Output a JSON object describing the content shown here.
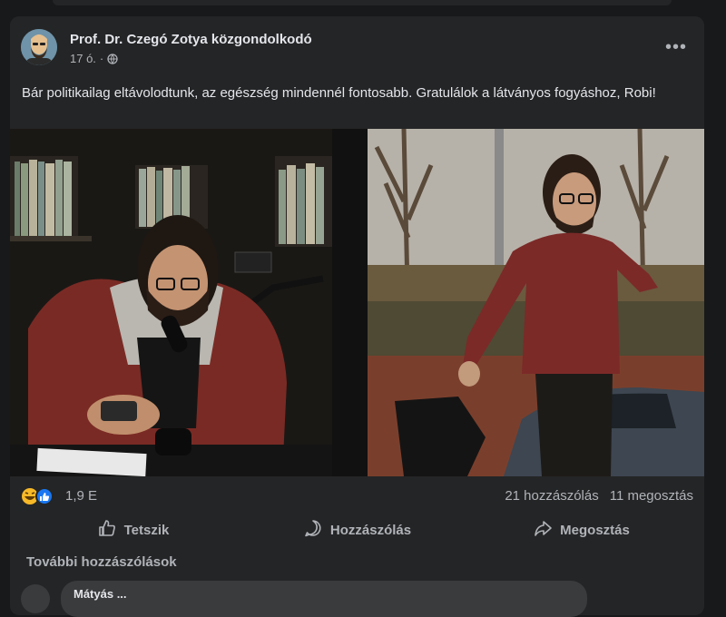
{
  "post": {
    "author": "Prof. Dr. Czegó Zotya közgondolkodó",
    "time": "17 ó.",
    "separator": "·",
    "privacy_icon": "globe-icon",
    "more_icon": "•••",
    "text": "Bár politikailag eltávolodtunk, az egészség mindennél fontosabb. Gratulálok a látványos fogyáshoz, Robi!"
  },
  "reactions": {
    "icons": [
      "haha-icon",
      "like-icon"
    ],
    "count": "1,9 E",
    "comments": "21 hozzászólás",
    "shares": "11 megosztás"
  },
  "actions": {
    "like": "Tetszik",
    "comment": "Hozzászólás",
    "share": "Megosztás"
  },
  "comments": {
    "more_label": "További hozzászólások",
    "first_name": "Mátyás ..."
  },
  "colors": {
    "card": "#242526",
    "background": "#18191a",
    "text": "#e4e6eb",
    "muted": "#b0b3b8",
    "like_blue": "#1877f2",
    "haha_yellow": "#f7b928"
  }
}
